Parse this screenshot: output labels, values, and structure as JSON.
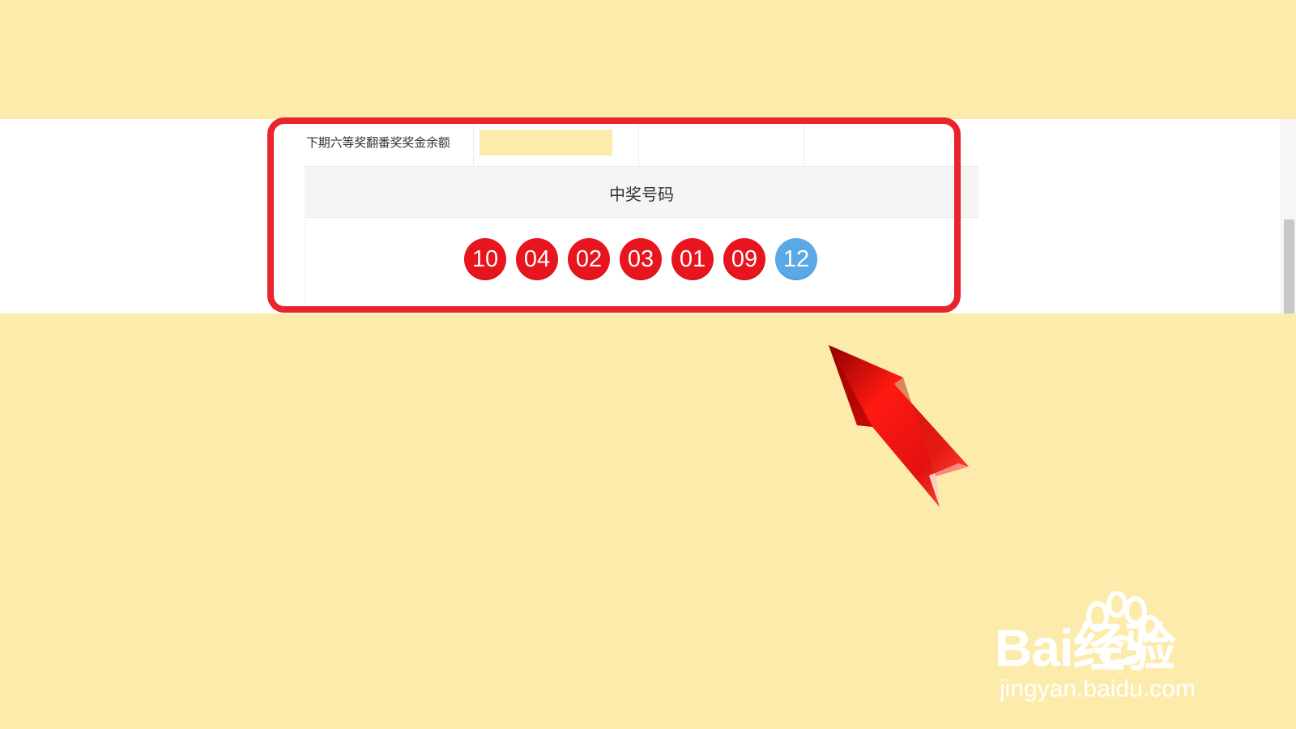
{
  "prize_table": {
    "balance_label": "下期六等奖翻番奖奖金余额",
    "header": "中奖号码",
    "red_balls": [
      "10",
      "04",
      "02",
      "03",
      "01",
      "09"
    ],
    "blue_ball": "12"
  },
  "watermark": {
    "brand": "Bai经验",
    "site": "jingyan.baidu.com"
  },
  "colors": {
    "background": "#fcebaa",
    "annotation_red": "#e9242d",
    "red_ball": "#e8141e",
    "blue_ball": "#5aa9e6"
  },
  "icons": {
    "annotation": "arrow-pointer-icon",
    "watermark": "paw-icon"
  }
}
